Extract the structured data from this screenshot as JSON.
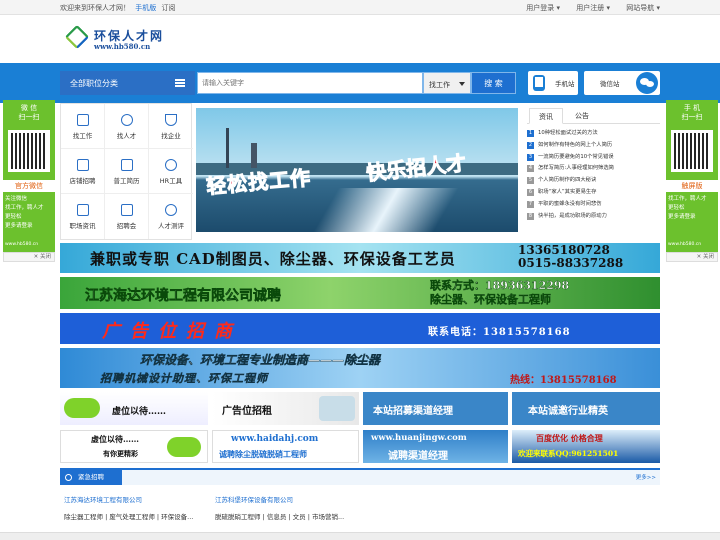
{
  "topbar": {
    "welcome": "欢迎来到环保人才网！",
    "mobile": "手机版",
    "subscribe": "订阅",
    "links": [
      "用户登录 ▾",
      "用户注册 ▾",
      "网站导航 ▾"
    ]
  },
  "logo": {
    "name": "环保人才网",
    "url": "www.hb580.cn"
  },
  "search": {
    "category_label": "全部职位分类",
    "placeholder": "请输入关键字",
    "type_label": "找工作",
    "button_label": "搜 索",
    "mobile_site": "手机站",
    "wechat": "微信站"
  },
  "nav_items": [
    {
      "label": "找工作",
      "icon": "briefcase-icon"
    },
    {
      "label": "找人才",
      "icon": "person-icon"
    },
    {
      "label": "找企业",
      "icon": "trophy-icon"
    },
    {
      "label": "店铺招聘",
      "icon": "store-icon"
    },
    {
      "label": "普工简历",
      "icon": "resume-icon"
    },
    {
      "label": "HR工具",
      "icon": "tools-icon"
    },
    {
      "label": "职场资讯",
      "icon": "news-icon"
    },
    {
      "label": "招聘会",
      "icon": "calendar-icon"
    },
    {
      "label": "人才测评",
      "icon": "test-icon"
    }
  ],
  "banner": {
    "text1": "轻松找工作",
    "text2": "快乐招人才"
  },
  "news": {
    "tabs": [
      "资讯",
      "公告"
    ],
    "items": [
      "10种轻松面试过关的方法",
      "如何制作有特色的网上个人简历",
      "一流简历要避免的10个常见错误",
      "怎样写简历:人事经理如何筛选简",
      "个人简历制作的四大秘诀",
      "职场“家人”其实更易生存",
      "平职的蜜蜂永没有时间悲伤",
      "快半拍，是成功职场的原动力"
    ]
  },
  "side_left": {
    "title": "微 信\n扫一扫",
    "label": "官方微信",
    "text": "关注微信\n找工作，聘人才\n更轻松",
    "more": "更多请登录",
    "url": "www.hb580.cn",
    "close": "✕ 关闭"
  },
  "side_right": {
    "title": "手 机\n扫一扫",
    "label": "触屏版",
    "text": "找工作，聘人才\n更轻松",
    "more": "更多请登录",
    "url": "www.hb580.cn",
    "close": "✕ 关闭"
  },
  "ads": {
    "ad1": {
      "text": "兼职或专职 CAD制图员、除尘器、环保设备工艺员",
      "phone1": "13365180728",
      "phone2": "0515-88337288"
    },
    "ad2": {
      "text": "江苏海达环境工程有限公司诚聘",
      "contact": "联系方式：18936312298",
      "jobs": "除尘器、环保设备工程师"
    },
    "ad3": {
      "text": "广告位招商",
      "phone": "联系电话：13815578168"
    },
    "ad4": {
      "line1": "环保设备、环境工程专业制造商———除尘器",
      "line2": "招聘机械设计助理、环保工程师",
      "hotline": "热线：13815578168"
    },
    "tiles": [
      {
        "t1": "虚位以待……",
        "t2": ""
      },
      {
        "t1": "广告位招租",
        "t2": ""
      },
      {
        "t1": "本站招募渠道经理",
        "t2": ""
      },
      {
        "t1": "本站诚邀行业精英",
        "t2": ""
      },
      {
        "t1": "虚位以待……",
        "t2": "有你更精彩"
      },
      {
        "t1": "www.haidahj.com",
        "t2": "诚聘除尘脱硫脱硝工程师"
      },
      {
        "t1": "www.huanjingw.com",
        "t2": "诚聘渠道经理"
      },
      {
        "t1": "百度优化  价格合理",
        "t2": "欢迎来联系QQ:961251501"
      }
    ]
  },
  "urgent": {
    "title": "紧急招聘",
    "more": "更多>>",
    "companies": [
      {
        "name": "江苏海达环境工程有限公司",
        "jobs": "除尘器工程师 | 废气处理工程师 | 环保设备..."
      },
      {
        "name": "江苏科堡环保设备有限公司",
        "jobs": "脱硫脱硝工程师 | 信息员 | 文员 | 市场营销..."
      }
    ]
  }
}
